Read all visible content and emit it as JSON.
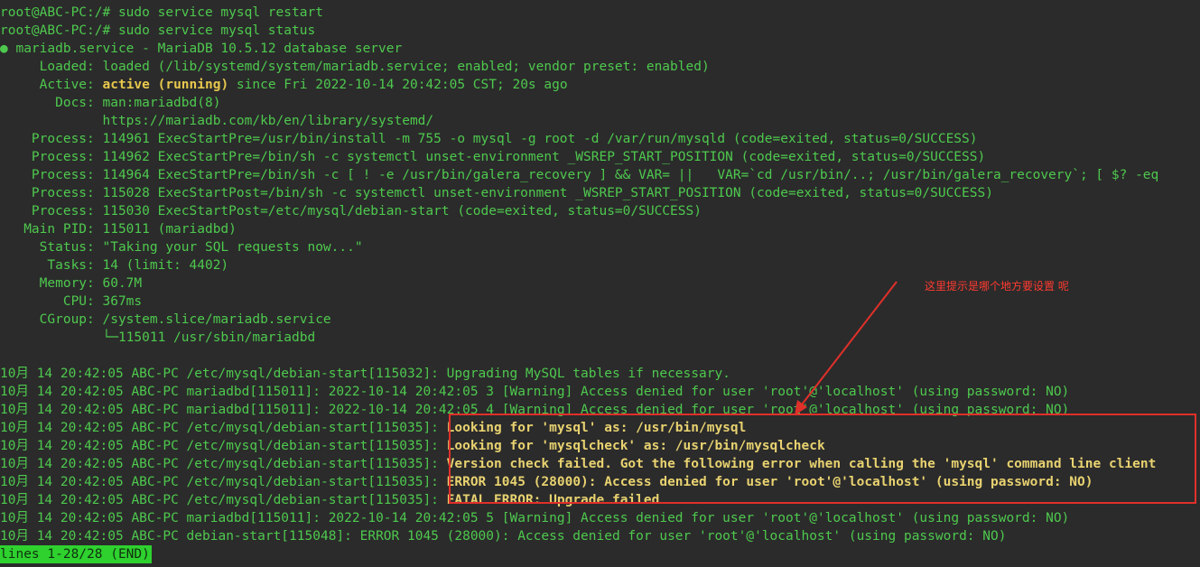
{
  "terminal": {
    "lines": [
      "root@ABC-PC:/# sudo service mysql restart",
      "root@ABC-PC:/# sudo service mysql status",
      "",
      "     Loaded: loaded (/lib/systemd/system/mariadb.service; enabled; vendor preset: enabled)",
      "",
      "       Docs: man:mariadbd(8)",
      "             https://mariadb.com/kb/en/library/systemd/",
      "    Process: 114961 ExecStartPre=/usr/bin/install -m 755 -o mysql -g root -d /var/run/mysqld (code=exited, status=0/SUCCESS)",
      "    Process: 114962 ExecStartPre=/bin/sh -c systemctl unset-environment _WSREP_START_POSITION (code=exited, status=0/SUCCESS)",
      "    Process: 114964 ExecStartPre=/bin/sh -c [ ! -e /usr/bin/galera_recovery ] && VAR= ||   VAR=`cd /usr/bin/..; /usr/bin/galera_recovery`; [ $? -eq",
      "    Process: 115028 ExecStartPost=/bin/sh -c systemctl unset-environment _WSREP_START_POSITION (code=exited, status=0/SUCCESS)",
      "    Process: 115030 ExecStartPost=/etc/mysql/debian-start (code=exited, status=0/SUCCESS)",
      "   Main PID: 115011 (mariadbd)",
      "     Status: \"Taking your SQL requests now...\"",
      "      Tasks: 14 (limit: 4402)",
      "     Memory: 60.7M",
      "        CPU: 367ms",
      "     CGroup: /system.slice/mariadb.service",
      "             └─115011 /usr/sbin/mariadbd",
      "",
      "10月 14 20:42:05 ABC-PC /etc/mysql/debian-start[115032]: Upgrading MySQL tables if necessary.",
      "10月 14 20:42:05 ABC-PC mariadbd[115011]: 2022-10-14 20:42:05 3 [Warning] Access denied for user 'root'@'localhost' (using password: NO)",
      "10月 14 20:42:05 ABC-PC mariadbd[115011]: 2022-10-14 20:42:05 4 [Warning] Access denied for user 'root'@'localhost' (using password: NO)",
      "",
      "",
      "",
      "",
      "",
      "10月 14 20:42:05 ABC-PC mariadbd[115011]: 2022-10-14 20:42:05 5 [Warning] Access denied for user 'root'@'localhost' (using password: NO)",
      "10月 14 20:42:05 ABC-PC debian-start[115048]: ERROR 1045 (28000): Access denied for user 'root'@'localhost' (using password: NO)"
    ],
    "unit_line": {
      "bullet": "●",
      "text": " mariadb.service - MariaDB 10.5.12 database server"
    },
    "active_line": {
      "prefix": "     Active: ",
      "state": "active (running)",
      "suffix": " since Fri 2022-10-14 20:42:05 CST; 20s ago"
    },
    "debian_lines": [
      {
        "prefix": "10月 14 20:42:05 ABC-PC /etc/mysql/debian-start[115035]: ",
        "message": "Looking for 'mysql' as: /usr/bin/mysql"
      },
      {
        "prefix": "10月 14 20:42:05 ABC-PC /etc/mysql/debian-start[115035]: ",
        "message": "Looking for 'mysqlcheck' as: /usr/bin/mysqlcheck"
      },
      {
        "prefix": "10月 14 20:42:05 ABC-PC /etc/mysql/debian-start[115035]: ",
        "message": "Version check failed. Got the following error when calling the 'mysql' command line client"
      },
      {
        "prefix": "10月 14 20:42:05 ABC-PC /etc/mysql/debian-start[115035]: ",
        "message": "ERROR 1045 (28000): Access denied for user 'root'@'localhost' (using password: NO)"
      },
      {
        "prefix": "10月 14 20:42:05 ABC-PC /etc/mysql/debian-start[115035]: ",
        "message": "FATAL ERROR: Upgrade failed"
      }
    ],
    "status_bar": "lines 1-28/28 (END)"
  },
  "annotation": {
    "text": "这里提示是哪个地方要设置 呢",
    "color": "#ff3b30"
  },
  "colors": {
    "background": "#2b2b2b",
    "text": "#4ec94e",
    "highlight": "#e8c84c",
    "status_bar_bg": "#2ed12e",
    "annotation_red": "#e0302a"
  }
}
